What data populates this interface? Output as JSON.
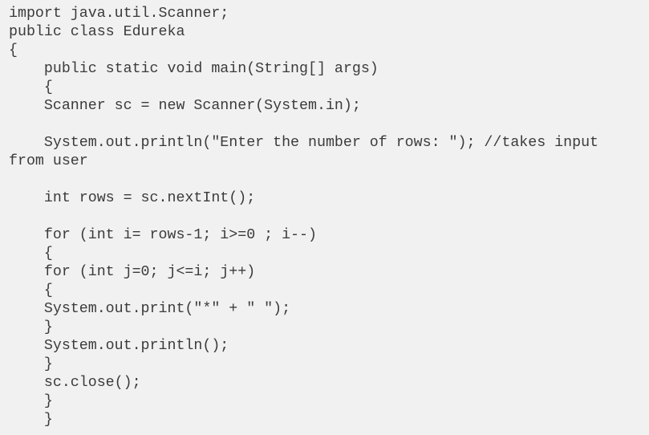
{
  "code": {
    "lines": [
      "import java.util.Scanner;",
      "public class Edureka",
      "{",
      "    public static void main(String[] args)",
      "    {",
      "    Scanner sc = new Scanner(System.in);",
      "",
      "    System.out.println(\"Enter the number of rows: \"); //takes input",
      "from user",
      "",
      "    int rows = sc.nextInt();",
      "",
      "    for (int i= rows-1; i>=0 ; i--)",
      "    {",
      "    for (int j=0; j<=i; j++)",
      "    {",
      "    System.out.print(\"*\" + \" \");",
      "    }",
      "    System.out.println();",
      "    }",
      "    sc.close();",
      "    }",
      "    }"
    ]
  }
}
